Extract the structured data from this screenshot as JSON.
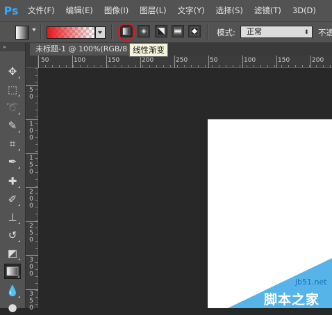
{
  "app": {
    "logo": "Ps"
  },
  "menu": [
    "文件(F)",
    "编辑(E)",
    "图像(I)",
    "图层(L)",
    "文字(Y)",
    "选择(S)",
    "滤镜(T)",
    "3D(D)"
  ],
  "options": {
    "gradient_types": [
      "linear-gradient",
      "radial-gradient",
      "angle-gradient",
      "reflected-gradient",
      "diamond-gradient"
    ],
    "active_gradient_type": "linear-gradient",
    "gradient_colors": {
      "start": "#e8141a",
      "end": "transparent"
    },
    "mode_label": "模式:",
    "mode_value": "正常",
    "opacity_label": "不透"
  },
  "tooltip": "线性渐变",
  "document": {
    "tab_title": "未标题-1 @ 100%(RGB/8"
  },
  "ruler": {
    "h_labels": [
      "50",
      "100",
      "150",
      "200",
      "250",
      "50",
      "100",
      "150",
      "200"
    ],
    "v_labels": [
      "5 0",
      "1 0 0",
      "1 5 0",
      "2 0 0",
      "2 5 0",
      "3 0 0",
      "3 5 0"
    ]
  },
  "tools": [
    "move",
    "marquee",
    "lasso",
    "quick-selection",
    "crop",
    "eyedropper",
    "healing-brush",
    "brush",
    "clone-stamp",
    "history-brush",
    "eraser",
    "gradient",
    "blur",
    "dodge"
  ],
  "active_tool": "gradient",
  "colors": {
    "accent": "#31a8ff",
    "highlight_circle": "#d8191e",
    "canvas": "#ffffff",
    "workspace": "#282828"
  },
  "watermark": {
    "site": "jb51.net",
    "name": "脚本之家"
  }
}
